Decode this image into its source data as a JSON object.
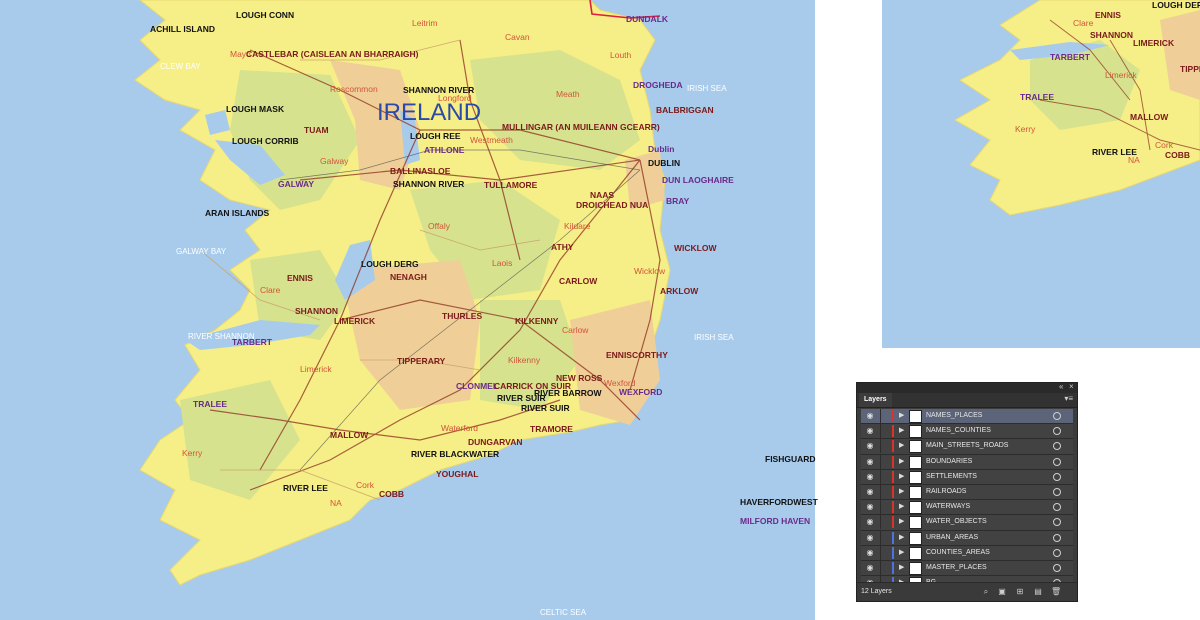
{
  "map": {
    "title": "IRELAND",
    "colors": {
      "sea": "#a8cbec",
      "land": "#f6ee86",
      "county_green": "#d6e28e",
      "county_tan": "#efcf97",
      "road_main": "#8c2f1e",
      "road_minor": "#c8a26a",
      "county_border": "#9b8fb6",
      "rail": "#4a4a4a"
    },
    "labels": {
      "achill_island": "ACHILL ISLAND",
      "lough_conn": "LOUGH CONN",
      "clew_bay": "CLEW BAY",
      "mayo": "Mayo",
      "castlebar": "CASTLEBAR (CAISLEAN AN BHARRAIGH)",
      "leitrim": "Leitrim",
      "cavan": "Cavan",
      "louth": "Louth",
      "dundalk": "DUNDALK",
      "shannon_river_north": "SHANNON RIVER",
      "longford": "Longford",
      "roscommon": "Roscommon",
      "lough_mask": "LOUGH MASK",
      "tuam": "TUAM",
      "lough_corrib": "LOUGH CORRIB",
      "lough_ree": "LOUGH REE",
      "athlone": "ATHLONE",
      "mullingar": "MULLINGAR (AN MUILEANN GCEARR)",
      "westmeath": "Westmeath",
      "meath": "Meath",
      "drogheda": "DROGHEDA",
      "irish_sea_north": "IRISH SEA",
      "balbriggan": "BALBRIGGAN",
      "dublin_county": "Dublin",
      "dublin": "DUBLIN",
      "dun_laoghaire": "DUN LAOGHAIRE",
      "galway_county": "Galway",
      "galway": "GALWAY",
      "ballinasloe": "BALLINASLOE",
      "shannon_river_mid": "SHANNON RIVER",
      "tullamore": "TULLAMORE",
      "naas": "NAAS",
      "droichead_nua": "DROICHEAD NUA",
      "bray": "BRAY",
      "aran_islands": "ARAN ISLANDS",
      "offaly": "Offaly",
      "kildare": "Kildare",
      "galway_bay": "GALWAY BAY",
      "athy": "ATHY",
      "wicklow": "WICKLOW",
      "lough_derg": "LOUGH DERG",
      "laois": "Laois",
      "nenagh": "NENAGH",
      "ennis": "ENNIS",
      "wicklow_county": "Wicklow",
      "clare": "Clare",
      "carlow": "CARLOW",
      "arklow": "ARKLOW",
      "shannon": "SHANNON",
      "thurles": "THURLES",
      "limerick": "LIMERICK",
      "kilkenny": "KILKENNY",
      "river_shannon": "RIVER SHANNON",
      "carlow_county": "Carlow",
      "irish_sea_south": "IRISH SEA",
      "tarbert": "TARBERT",
      "tipperary": "TIPPERARY",
      "kilkenny_county": "Kilkenny",
      "enniscorthy": "ENNISCORTHY",
      "limerick_county": "Limerick",
      "new_ross": "NEW ROSS",
      "clonmel": "CLONMEL",
      "carrick_on_suir": "CARRICK ON SUIR",
      "wexford_county": "Wexford",
      "river_barrow": "RIVER BARROW",
      "tralee": "TRALEE",
      "river_suir_1": "RIVER SUIR",
      "wexford": "WEXFORD",
      "river_suir_2": "RIVER SUIR",
      "waterford_county": "Waterford",
      "tramore": "TRAMORE",
      "mallow": "MALLOW",
      "dungarvan": "DUNGARVAN",
      "kerry": "Kerry",
      "river_blackwater": "RIVER BLACKWATER",
      "fishguard": "FISHGUARD",
      "youghal": "YOUGHAL",
      "river_lee": "RIVER LEE",
      "cork_county": "Cork",
      "cobb": "COBB",
      "haverfordwest": "HAVERFORDWEST",
      "na": "NA",
      "milford_haven": "MILFORD HAVEN",
      "celtic_sea": "CELTIC SEA"
    },
    "inset_labels": {
      "lough_derg": "LOUGH DERG",
      "ennis": "ENNIS",
      "limerick": "LIMERICK",
      "clare": "Clare",
      "shannon": "SHANNON",
      "tarbert": "TARBERT",
      "limerick_county": "Limerick",
      "tipperary": "TIPPE",
      "tralee": "TRALEE",
      "kerry": "Kerry",
      "mallow": "MALLOW",
      "river_lee": "RIVER LEE",
      "na": "NA",
      "cobb": "COBB",
      "cork": "Cork"
    }
  },
  "layers_panel": {
    "tab_label": "Layers",
    "count_label": "12 Layers",
    "layers": [
      {
        "name": "NAMES_PLACES",
        "color": "#d9342b",
        "selected": true
      },
      {
        "name": "NAMES_COUNTIES",
        "color": "#d9342b",
        "selected": false
      },
      {
        "name": "MAIN_STREETS_ROADS",
        "color": "#d9342b",
        "selected": false
      },
      {
        "name": "BOUNDARIES",
        "color": "#d9342b",
        "selected": false
      },
      {
        "name": "SETTLEMENTS",
        "color": "#d9342b",
        "selected": false
      },
      {
        "name": "RAILROADS",
        "color": "#d9342b",
        "selected": false
      },
      {
        "name": "WATERWAYS",
        "color": "#d9342b",
        "selected": false
      },
      {
        "name": "WATER_OBJECTS",
        "color": "#d9342b",
        "selected": false
      },
      {
        "name": "URBAN_AREAS",
        "color": "#4f73d9",
        "selected": false
      },
      {
        "name": "COUNTIES_AREAS",
        "color": "#4f73d9",
        "selected": false
      },
      {
        "name": "MASTER_PLACES",
        "color": "#4f73d9",
        "selected": false
      },
      {
        "name": "BG",
        "color": "#4f73d9",
        "selected": false
      }
    ]
  }
}
